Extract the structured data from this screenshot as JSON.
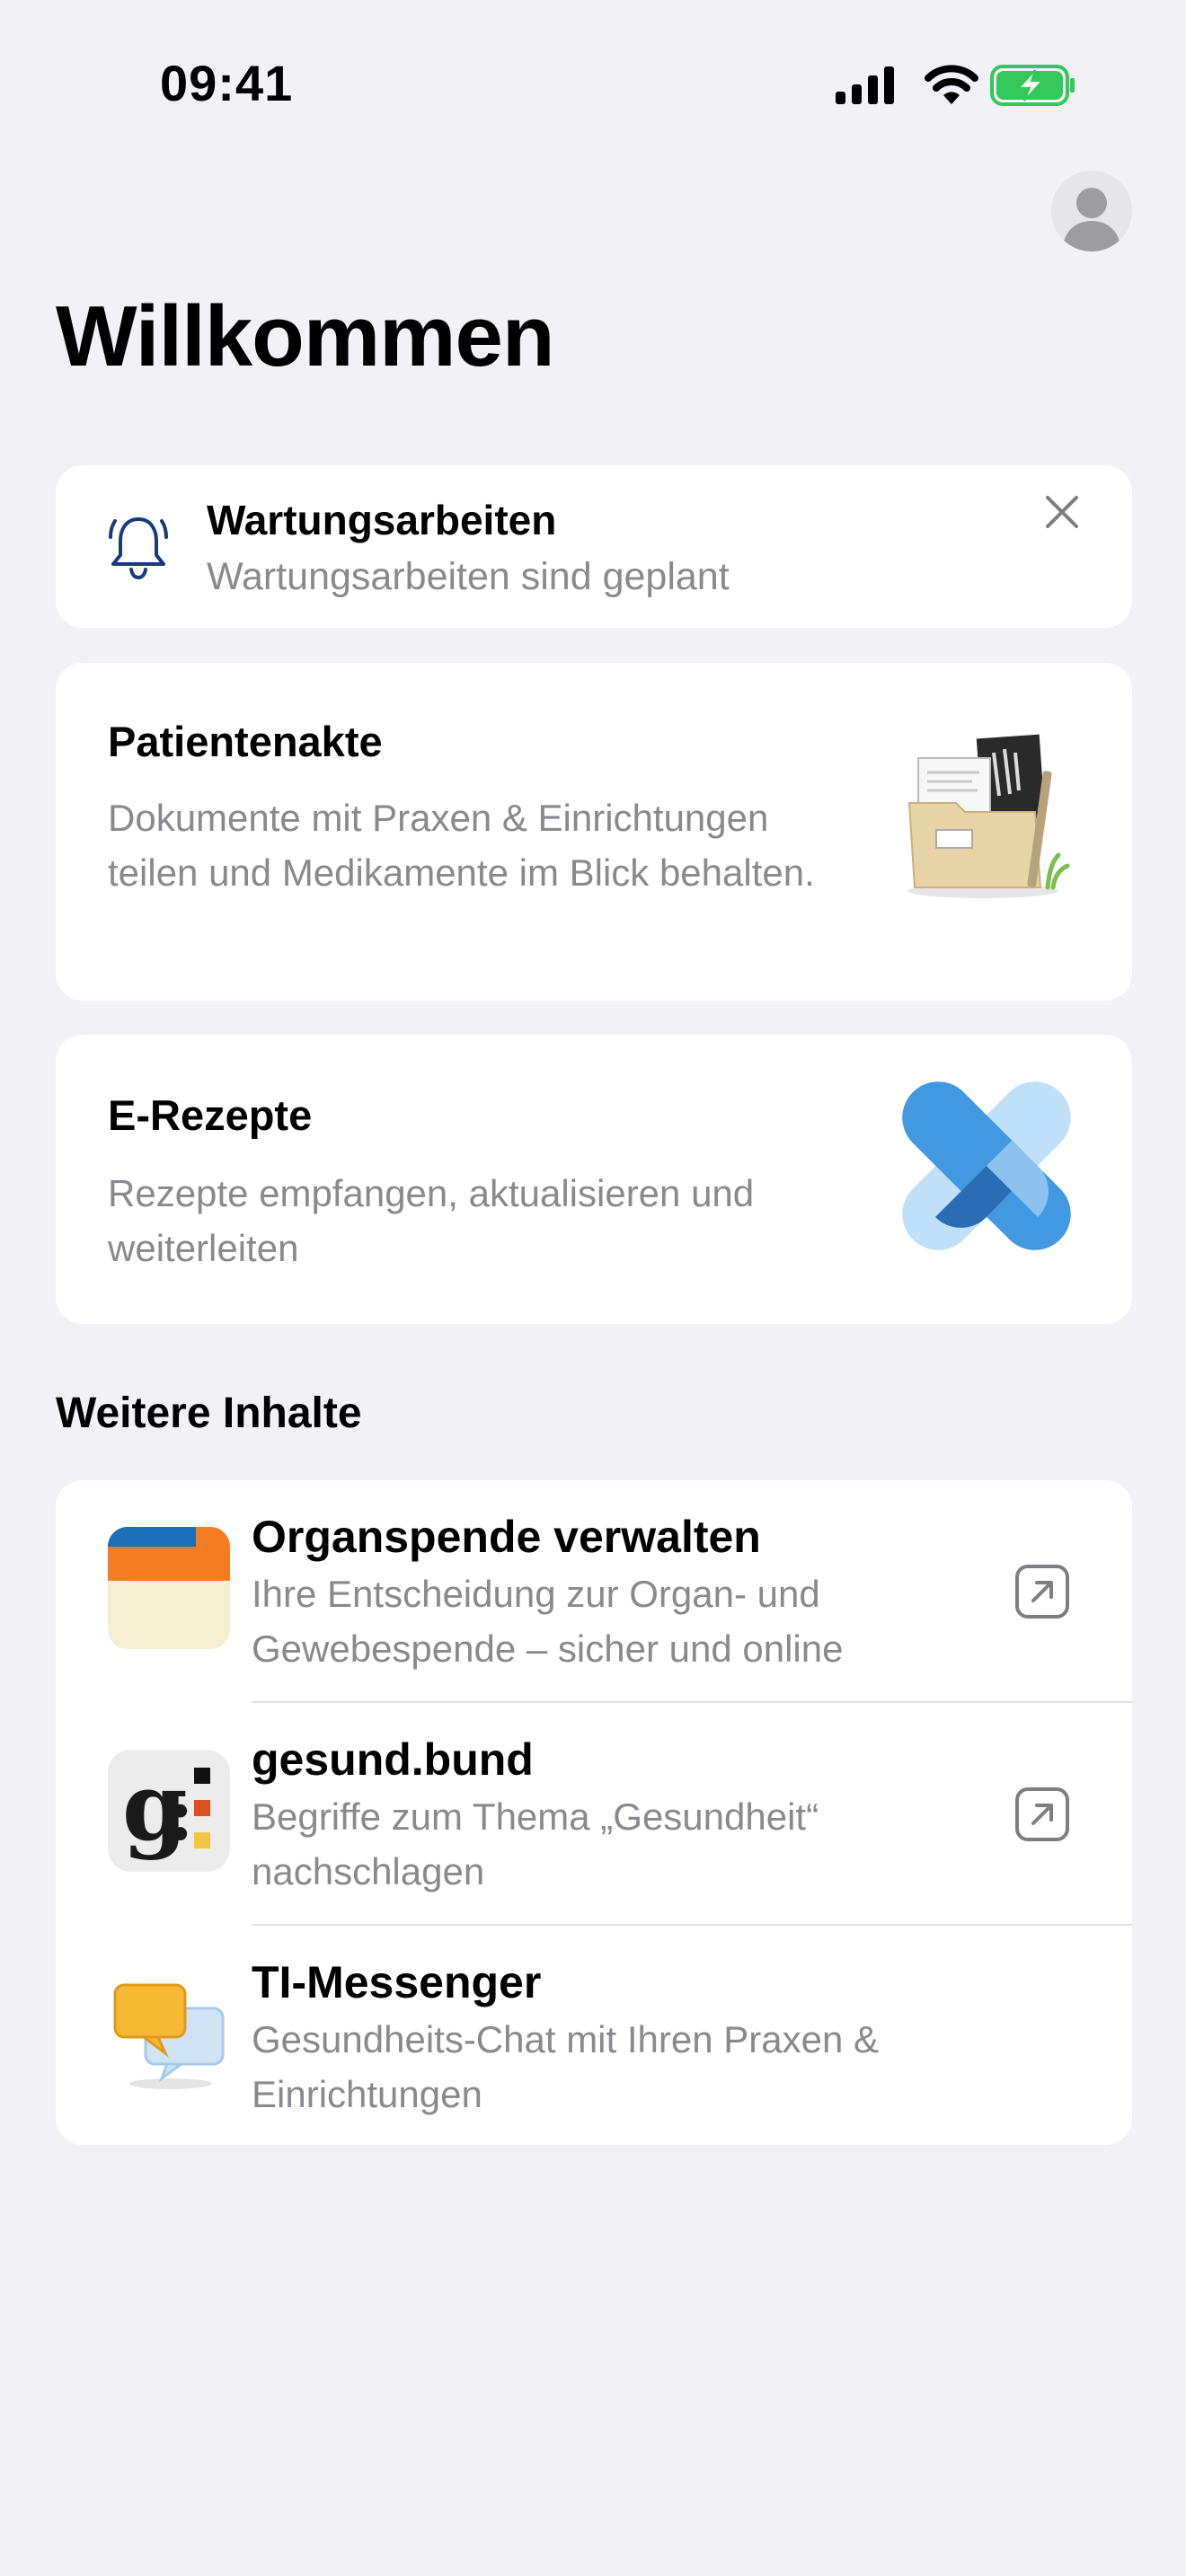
{
  "status_bar": {
    "time": "09:41"
  },
  "header": {
    "title": "Willkommen"
  },
  "notice": {
    "title": "Wartungsarbeiten",
    "subtitle": "Wartungsarbeiten sind geplant",
    "icon": "bell-icon",
    "dismiss_icon": "close-icon"
  },
  "features": [
    {
      "title": "Patientenakte",
      "description": "Dokumente mit Praxen & Einrichtungen teilen und Medikamente im Blick behalten.",
      "icon": "folder-illustration"
    },
    {
      "title": "E-Rezepte",
      "description": "Rezepte empfangen, aktualisieren und weiterleiten",
      "icon": "e-prescription-illustration"
    }
  ],
  "more": {
    "section_title": "Weitere Inhalte",
    "items": [
      {
        "title": "Organspende verwalten",
        "description": "Ihre Entscheidung zur Organ- und Gewebespende – sicher und online",
        "icon": "organ-donation-card-icon",
        "trailing_icon": "external-link-icon"
      },
      {
        "title": "gesund.bund",
        "description": "Begriffe zum Thema „Gesundheit“ nachschlagen",
        "icon": "gesund-bund-icon",
        "trailing_icon": "external-link-icon"
      },
      {
        "title": "TI-Messenger",
        "description": "Gesundheits-Chat mit Ihren Praxen & Einrichtungen",
        "icon": "chat-bubbles-icon"
      }
    ]
  },
  "colors": {
    "background": "#f1f1f6",
    "card": "#ffffff",
    "secondary_text": "#8a8a8e",
    "accent_blue": "#4398e2",
    "battery_green": "#34c759"
  }
}
